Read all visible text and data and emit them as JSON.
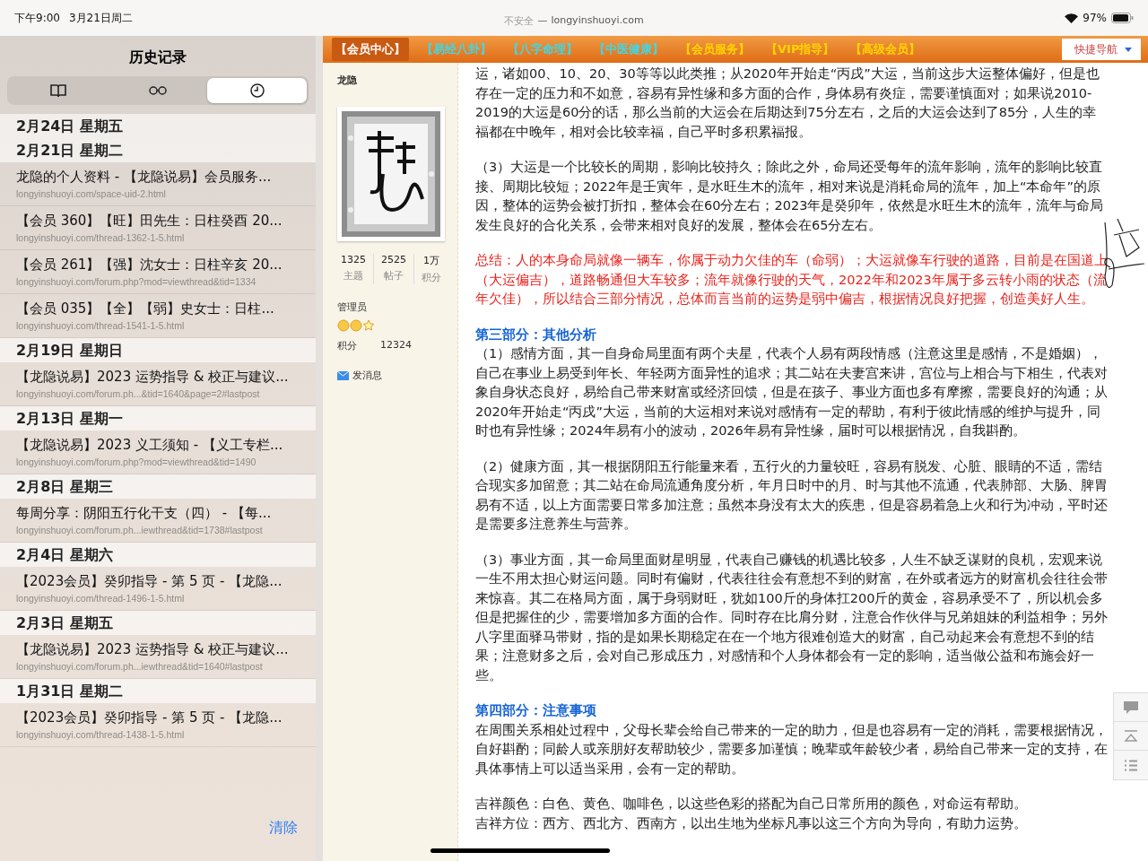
{
  "status_bar": {
    "time": "下午9:00",
    "date": "3月21日周二",
    "security": "不安全",
    "separator": "—",
    "domain": "longyinshuoyi.com",
    "battery": "97%"
  },
  "sidebar": {
    "title": "历史记录",
    "segments": [
      {
        "kind": "bookmarks",
        "selected": false
      },
      {
        "kind": "reading_list",
        "selected": false
      },
      {
        "kind": "history",
        "selected": true
      }
    ],
    "groups": [
      {
        "date": "2月24日 星期五"
      },
      {
        "date": "2月21日 星期二",
        "entries": [
          {
            "title": "龙隐的个人资料 - 【龙隐说易】会员服务...",
            "url": "longyinshuoyi.com/space-uid-2.html"
          },
          {
            "title": "【会员 360】【旺】田先生：日柱癸酉 20...",
            "url": "longyinshuoyi.com/thread-1362-1-5.html"
          },
          {
            "title": "【会员 261】【强】沈女士：日柱辛亥 20...",
            "url": "longyinshuoyi.com/forum.php?mod=viewthread&tid=1334"
          },
          {
            "title": "【会员 035】【全】【弱】史女士：日柱...",
            "url": "longyinshuoyi.com/thread-1541-1-5.html"
          }
        ]
      },
      {
        "date": "2月19日 星期日",
        "entries": [
          {
            "title": "【龙隐说易】2023 运势指导 & 校正与建议...",
            "url": "longyinshuoyi.com/forum.ph...&tid=1640&page=2#lastpost"
          }
        ]
      },
      {
        "date": "2月13日 星期一",
        "entries": [
          {
            "title": "【龙隐说易】2023 义工须知 - 【义工专栏...",
            "url": "longyinshuoyi.com/forum.php?mod=viewthread&tid=1490"
          }
        ]
      },
      {
        "date": "2月8日 星期三",
        "entries": [
          {
            "title": "每周分享：阴阳五行化干支（四） - 【每...",
            "url": "longyinshuoyi.com/forum.ph...iewthread&tid=1738#lastpost"
          }
        ]
      },
      {
        "date": "2月4日 星期六",
        "entries": [
          {
            "title": "【2023会员】癸卯指导 - 第 5 页 - 【龙隐...",
            "url": "longyinshuoyi.com/thread-1496-1-5.html"
          }
        ]
      },
      {
        "date": "2月3日 星期五",
        "entries": [
          {
            "title": "【龙隐说易】2023 运势指导 & 校正与建议...",
            "url": "longyinshuoyi.com/forum.ph...iewthread&tid=1640#lastpost"
          }
        ]
      },
      {
        "date": "1月31日 星期二",
        "entries": [
          {
            "title": "【2023会员】癸卯指导 - 第 5 页 - 【龙隐...",
            "url": "longyinshuoyi.com/thread-1438-1-5.html"
          }
        ]
      }
    ],
    "clear_button": "清除"
  },
  "nav": {
    "items": [
      {
        "label": "【会员中心】",
        "selected": true
      },
      {
        "label": "【易经八卦】",
        "selected": false,
        "color": "#3fd8e6"
      },
      {
        "label": "【八字命理】",
        "selected": false,
        "color": "#3fd8e6"
      },
      {
        "label": "【中医健康】",
        "selected": false,
        "color": "#3fd8e6"
      },
      {
        "label": "【会员服务】",
        "selected": false,
        "color": "#ffd400"
      },
      {
        "label": "【VIP指导】",
        "selected": false,
        "color": "#ffd400"
      },
      {
        "label": "【高级会员】",
        "selected": false,
        "color": "#ffd400"
      }
    ],
    "quick_nav": "快捷导航"
  },
  "profile": {
    "name": "龙隐",
    "stats": [
      {
        "value": "1325",
        "label": "主题"
      },
      {
        "value": "2525",
        "label": "帖子"
      },
      {
        "value": "1万",
        "label": "积分"
      }
    ],
    "group": "管理员",
    "points_label": "积分",
    "points": "12324",
    "message_link": "发消息"
  },
  "post": {
    "blocks": [
      {
        "kind": "paragraph",
        "text": "运，诸如00、10、20、30等等以此类推；从2020年开始走“丙戌”大运，当前这步大运整体偏好，但是也存在一定的压力和不如意，容易有异性缘和多方面的合作，身体易有炎症，需要谨慎面对；如果说2010-2019的大运是60分的话，那么当前的大运会在后期达到75分左右，之后的大运会达到了85分，人生的幸福都在中晚年，相对会比较幸福，自己平时多积累福报。"
      },
      {
        "kind": "paragraph",
        "text": "（3）大运是一个比较长的周期，影响比较持久；除此之外，命局还受每年的流年影响，流年的影响比较直接、周期比较短；2022年是壬寅年，是水旺生木的流年，相对来说是消耗命局的流年，加上“本命年”的原因，整体的运势会被打折扣，整体会在60分左右；2023年是癸卯年，依然是水旺生木的流年，流年与命局发生良好的合化关系，会带来相对良好的发展，整体会在65分左右。"
      },
      {
        "kind": "summary",
        "text": "总结：人的本身命局就像一辆车，你属于动力欠佳的车（命弱）；大运就像车行驶的道路，目前是在国道上（大运偏吉），道路畅通但大车较多；流年就像行驶的天气，2022年和2023年属于多云转小雨的状态（流年欠佳），所以结合三部分情况，总体而言当前的运势是弱中偏吉，根据情况良好把握，创造美好人生。"
      },
      {
        "kind": "heading",
        "text": "第三部分：其他分析"
      },
      {
        "kind": "paragraph",
        "text": "（1）感情方面，其一自身命局里面有两个夫星，代表个人易有两段情感（注意这里是感情，不是婚姻），自己在事业上易受到年长、年轻两方面异性的追求；其二站在夫妻宫来讲，宫位与上相合与下相生，代表对象自身状态良好，易给自己带来财富或经济回馈，但是在孩子、事业方面也多有摩擦，需要良好的沟通；从2020年开始走“丙戌”大运，当前的大运相对来说对感情有一定的帮助，有利于彼此情感的维护与提升，同时也有异性缘；2024年易有小的波动，2026年易有异性缘，届时可以根据情况，自我斟酌。"
      },
      {
        "kind": "paragraph",
        "text": "（2）健康方面，其一根据阴阳五行能量来看，五行火的力量较旺，容易有脱发、心脏、眼睛的不适，需结合现实多加留意；其二站在命局流通角度分析，年月日时中的月、时与其他不流通，代表肺部、大肠、脾胃易有不适，以上方面需要日常多加注意；虽然本身没有太大的疾患，但是容易着急上火和行为冲动，平时还是需要多注意养生与营养。"
      },
      {
        "kind": "paragraph",
        "text": "（3）事业方面，其一命局里面财星明显，代表自己赚钱的机遇比较多，人生不缺乏谋财的良机，宏观来说一生不用太担心财运问题。同时有偏财，代表往往会有意想不到的财富，在外或者远方的财富机会往往会带来惊喜。其二在格局方面，属于身弱财旺，犹如100斤的身体扛200斤的黄金，容易承受不了，所以机会多但是把握住的少，需要增加多方面的合作。同时存在比肩分财，注意合作伙伴与兄弟姐妹的利益相争；另外八字里面驿马带财，指的是如果长期稳定在在一个地方很难创造大的财富，自己动起来会有意想不到的结果；注意财多之后，会对自己形成压力，对感情和个人身体都会有一定的影响，适当做公益和布施会好一些。"
      },
      {
        "kind": "heading",
        "text": "第四部分：注意事项"
      },
      {
        "kind": "paragraph",
        "text": "在周围关系相处过程中，父母长辈会给自己带来的一定的助力，但是也容易有一定的消耗，需要根据情况，自好斟酌；同龄人或亲朋好友帮助较少，需要多加谨慎；晚辈或年龄较少者，易给自己带来一定的支持，在具体事情上可以适当采用，会有一定的帮助。"
      },
      {
        "kind": "line",
        "text": "吉祥颜色：白色、黄色、咖啡色，以这些色彩的搭配为自己日常所用的颜色，对命运有帮助。"
      },
      {
        "kind": "line",
        "text": "吉祥方位：西方、西北方、西南方，以出生地为坐标凡事以这三个方向为导向，有助力运势。"
      }
    ]
  }
}
